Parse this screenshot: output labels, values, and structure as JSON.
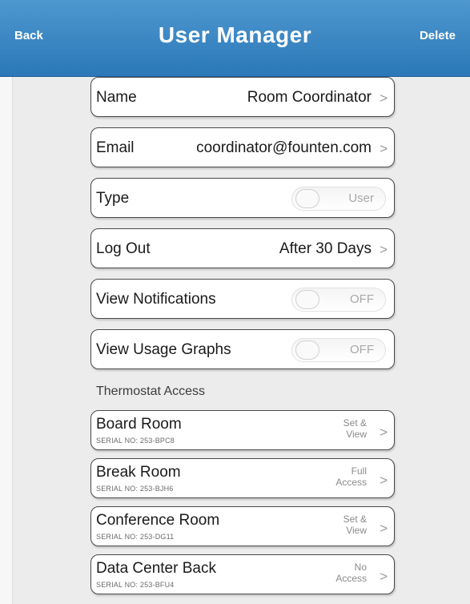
{
  "header": {
    "back_label": "Back",
    "title": "User Manager",
    "delete_label": "Delete"
  },
  "fields": {
    "name": {
      "label": "Name",
      "value": "Room Coordinator"
    },
    "email": {
      "label": "Email",
      "value": "coordinator@founten.com"
    },
    "type": {
      "label": "Type",
      "value": "User"
    },
    "logout": {
      "label": "Log Out",
      "value": "After 30 Days"
    },
    "view_notifications": {
      "label": "View Notifications",
      "value": "OFF"
    },
    "view_usage_graphs": {
      "label": "View Usage Graphs",
      "value": "OFF"
    }
  },
  "thermostat_access": {
    "section_label": "Thermostat Access",
    "items": [
      {
        "name": "Board Room",
        "serial": "SERIAL NO: 253-BPC8",
        "access_line1": "Set &",
        "access_line2": "View"
      },
      {
        "name": "Break Room",
        "serial": "SERIAL NO: 253-BJH6",
        "access_line1": "Full",
        "access_line2": "Access"
      },
      {
        "name": "Conference Room",
        "serial": "SERIAL NO: 253-DG11",
        "access_line1": "Set &",
        "access_line2": "View"
      },
      {
        "name": "Data Center Back",
        "serial": "SERIAL NO: 253-BFU4",
        "access_line1": "No",
        "access_line2": "Access"
      }
    ]
  },
  "colors": {
    "header_top": "#4e98cf",
    "header_bottom": "#2b78b8",
    "background": "#ececec",
    "row_border": "#4a4a4a"
  },
  "icons": {
    "chevron": "chevron-right-icon"
  }
}
